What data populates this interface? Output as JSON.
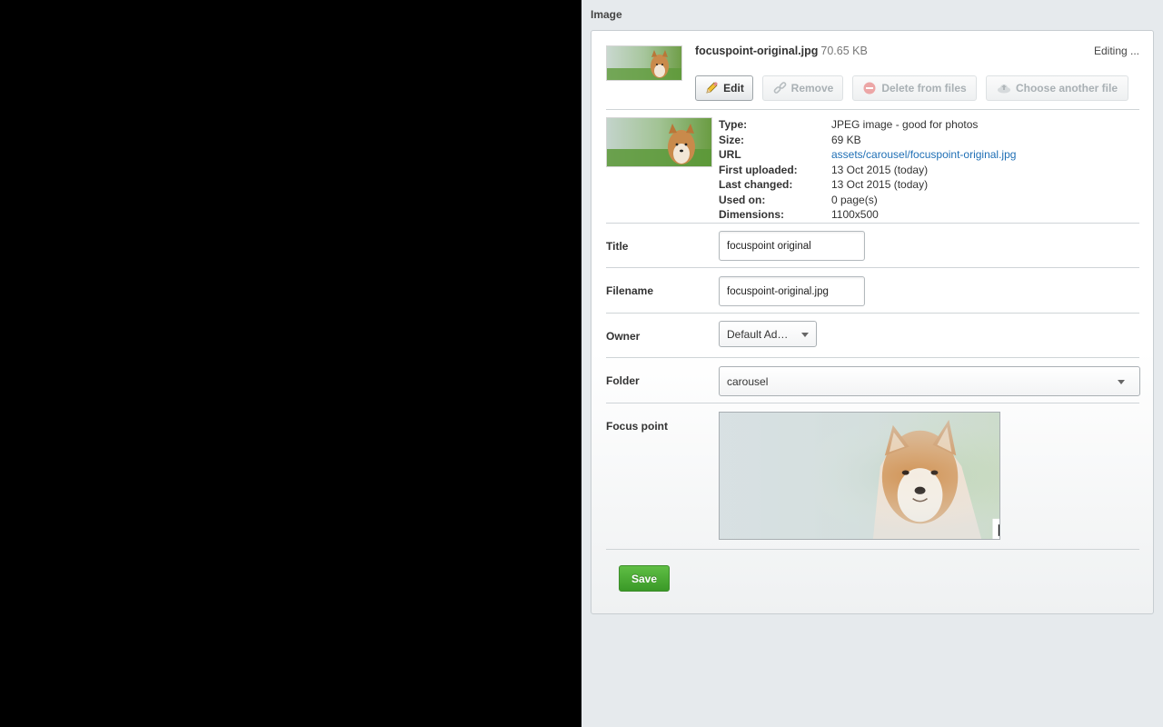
{
  "field": {
    "title": "Image"
  },
  "file": {
    "name": "focuspoint-original.jpg",
    "size": "70.65 KB",
    "status": "Editing ..."
  },
  "buttons": {
    "edit": "Edit",
    "remove": "Remove",
    "delete": "Delete from files",
    "choose": "Choose another file",
    "save": "Save"
  },
  "details": [
    {
      "label": "Type:",
      "value": "JPEG image - good for photos"
    },
    {
      "label": "Size:",
      "value": "69 KB"
    },
    {
      "label": "URL",
      "value": "assets/carousel/focuspoint-original.jpg"
    },
    {
      "label": "First uploaded:",
      "value": "13 Oct 2015 (today)"
    },
    {
      "label": "Last changed:",
      "value": "13 Oct 2015 (today)"
    },
    {
      "label": "Used on:",
      "value": "0 page(s)"
    },
    {
      "label": "Dimensions:",
      "value": "1100x500"
    }
  ],
  "form": {
    "title_label": "Title",
    "title_value": "focuspoint original",
    "filename_label": "Filename",
    "filename_value": "focuspoint-original.jpg",
    "owner_label": "Owner",
    "owner_value": "Default Ad…",
    "folder_label": "Folder",
    "folder_value": "carousel",
    "focus_label": "Focus point"
  },
  "icons": {
    "edit": "pencil-icon",
    "remove": "unlink-icon",
    "delete": "minus-circle-icon",
    "choose": "cloud-upload-icon",
    "focus": "crosshair-icon"
  },
  "colors": {
    "save_button": "#4aab33",
    "link": "#1f6fb5",
    "delete_icon": "#e05a5a"
  }
}
